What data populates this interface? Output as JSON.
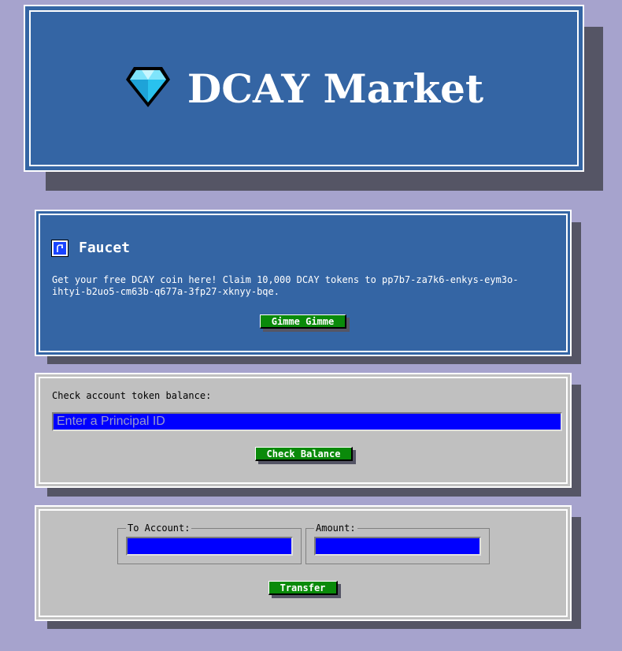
{
  "header": {
    "icon": "diamond-icon",
    "title": "DCAY Market"
  },
  "faucet": {
    "icon": "faucet-icon",
    "title": "Faucet",
    "description": "Get your free DCAY coin here! Claim 10,000 DCAY tokens to pp7b7-za7k6-enkys-eym3o-ihtyi-b2uo5-cm63b-q677a-3fp27-xknyy-bqe.",
    "button_label": "Gimme Gimme"
  },
  "balance": {
    "label": "Check account token balance:",
    "placeholder": "Enter a Principal ID",
    "value": "",
    "button_label": "Check Balance"
  },
  "transfer": {
    "to_account_legend": "To Account:",
    "to_account_value": "",
    "amount_legend": "Amount:",
    "amount_value": "",
    "button_label": "Transfer"
  },
  "colors": {
    "background": "#a6a3cd",
    "panel_blue": "#3465a4",
    "panel_grey": "#c0c0c0",
    "button_green": "#0a8a0a",
    "input_blue": "#0000ff"
  }
}
